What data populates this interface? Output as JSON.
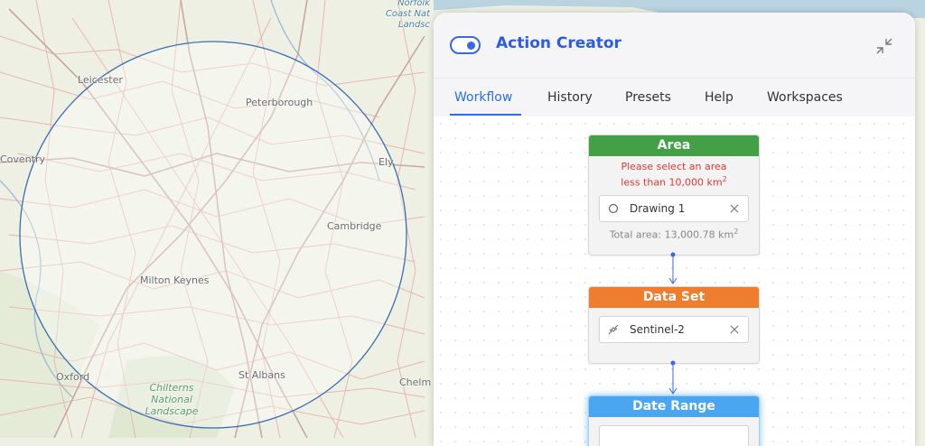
{
  "map": {
    "places": [
      {
        "name": "Leicester"
      },
      {
        "name": "Peterborough"
      },
      {
        "name": "Coventry"
      },
      {
        "name": "Ely"
      },
      {
        "name": "Cambridge"
      },
      {
        "name": "Milton Keynes"
      },
      {
        "name": "Oxford"
      },
      {
        "name": "St Albans"
      },
      {
        "name": "Chelm"
      }
    ],
    "aonb_chilterns": [
      "Chilterns",
      "National",
      "Landscape"
    ],
    "aonb_norfolk": [
      "Norfolk",
      "Coast Nat",
      "Landsc"
    ],
    "circle_color": "#3b6db4"
  },
  "panel": {
    "title": "Action Creator",
    "toggle_on": true,
    "accent": "#2b5ce6",
    "collapse_icon": "collapse-arrows-icon",
    "tabs": [
      {
        "label": "Workflow",
        "active": true
      },
      {
        "label": "History",
        "active": false
      },
      {
        "label": "Presets",
        "active": false
      },
      {
        "label": "Help",
        "active": false
      },
      {
        "label": "Workspaces",
        "active": false
      }
    ],
    "nodes": {
      "area": {
        "title": "Area",
        "color": "#43a047",
        "warning_line1": "Please select an area",
        "warning_line2": "less than 10,000 km",
        "warning_sup": "2",
        "item_label": "Drawing 1",
        "item_icon": "circle-outline-icon",
        "total_text": "Total area: 13,000.78 km",
        "total_sup": "2"
      },
      "dataset": {
        "title": "Data Set",
        "color": "#ef7d2e",
        "item_label": "Sentinel-2",
        "item_icon": "satellite-icon"
      },
      "daterange": {
        "title": "Date Range",
        "color": "#4aa6f0"
      }
    }
  }
}
